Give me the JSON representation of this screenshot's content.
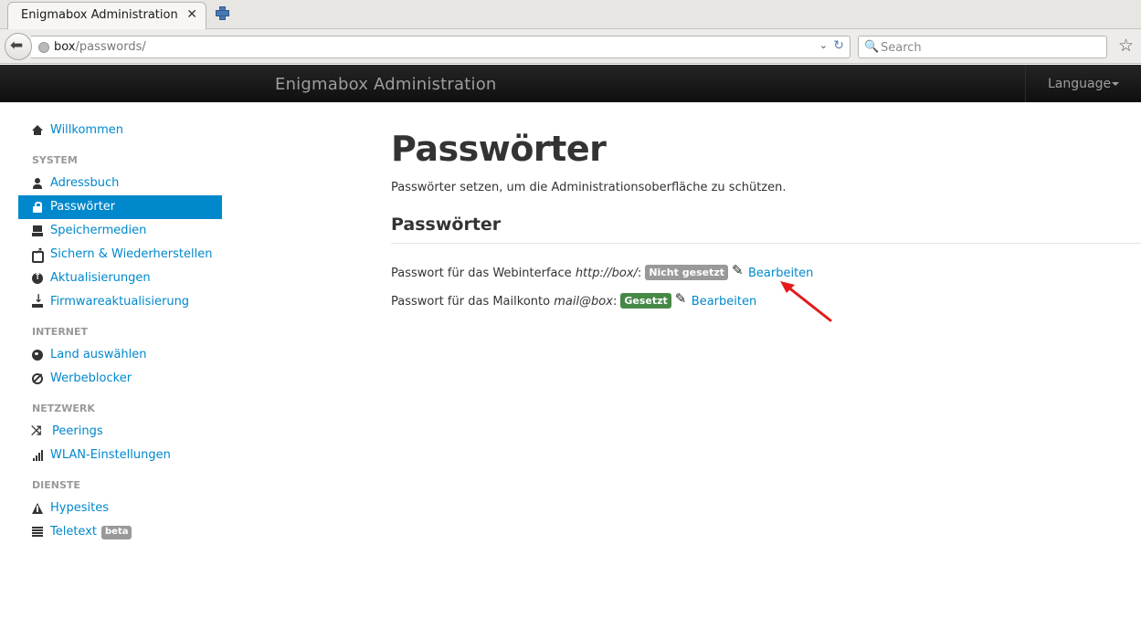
{
  "browser": {
    "tab_title": "Enigmabox Administration",
    "tab_close": "✕",
    "url_host": "box",
    "url_path": "/passwords/",
    "url_dropdown": "⌄",
    "reload": "↻",
    "search_placeholder": "Search",
    "bookmark": "☆",
    "back": "⬅",
    "search_glyph": "🔍"
  },
  "topbar": {
    "brand": "Enigmabox Administration",
    "language": "Language"
  },
  "sidebar": {
    "home": "Willkommen",
    "sections": [
      {
        "header": "SYSTEM",
        "items": [
          "Adressbuch",
          "Passwörter",
          "Speichermedien",
          "Sichern & Wiederherstellen",
          "Aktualisierungen",
          "Firmwareaktualisierung"
        ]
      },
      {
        "header": "INTERNET",
        "items": [
          "Land auswählen",
          "Werbeblocker"
        ]
      },
      {
        "header": "NETZWERK",
        "items": [
          "Peerings",
          "WLAN-Einstellungen"
        ]
      },
      {
        "header": "DIENSTE",
        "items": [
          "Hypesites",
          "Teletext"
        ]
      }
    ],
    "beta_badge": "beta",
    "active_item": "Passwörter"
  },
  "main": {
    "title": "Passwörter",
    "lead": "Passwörter setzen, um die Administrationsoberfläche zu schützen.",
    "section_title": "Passwörter",
    "rows": [
      {
        "label": "Passwort für das Webinterface ",
        "target": "http://box/",
        "badge": "Nicht gesetzt",
        "badge_color": "#999999",
        "action": "Bearbeiten"
      },
      {
        "label": "Passwort für das Mailkonto ",
        "target": "mail@box",
        "badge": "Gesetzt",
        "badge_color": "#468847",
        "action": "Bearbeiten"
      }
    ]
  },
  "colors": {
    "link": "#0088cc",
    "active_bg": "#0088cc",
    "topbar_bg": "#1b1b1b",
    "arrow": "#e31b1b"
  }
}
